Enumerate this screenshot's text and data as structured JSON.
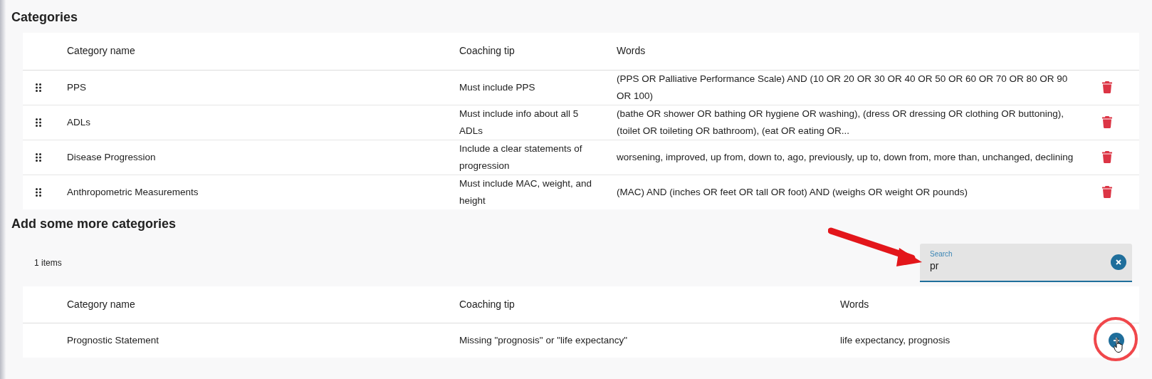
{
  "categories": {
    "title": "Categories",
    "columns": [
      "Category name",
      "Coaching tip",
      "Words"
    ],
    "rows": [
      {
        "name": "PPS",
        "tip": "Must include PPS",
        "words": "(PPS OR Palliative Performance Scale) AND (10 OR 20 OR 30 OR 40 OR 50 OR 60 OR 70 OR 80 OR 90 OR 100)"
      },
      {
        "name": "ADLs",
        "tip": "Must include info about all 5 ADLs",
        "words": "(bathe OR shower OR bathing OR hygiene OR washing), (dress OR dressing OR clothing OR buttoning), (toilet OR toileting OR bathroom), (eat OR eating OR..."
      },
      {
        "name": "Disease Progression",
        "tip": "Include a clear statements of progression",
        "words": "worsening, improved, up from, down to, ago, previously, up to, down from, more than, unchanged, declining"
      },
      {
        "name": "Anthropometric Measurements",
        "tip": "Must include MAC, weight, and height",
        "words": "(MAC) AND (inches OR feet OR tall OR foot) AND (weighs OR weight OR pounds)"
      }
    ]
  },
  "more": {
    "title": "Add some more categories",
    "count": "1 items",
    "search": {
      "label": "Search",
      "value": "pr"
    },
    "columns": [
      "Category name",
      "Coaching tip",
      "Words"
    ],
    "rows": [
      {
        "name": "Prognostic Statement",
        "tip": "Missing \"prognosis\" or \"life expectancy\"",
        "words": "life expectancy, prognosis"
      }
    ]
  }
}
